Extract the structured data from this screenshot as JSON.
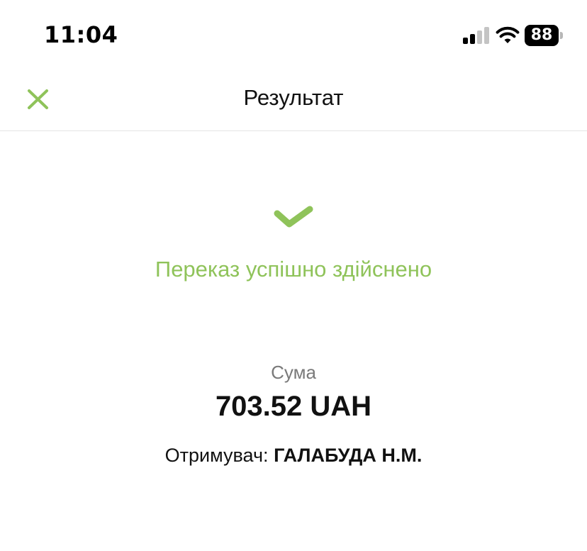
{
  "status_bar": {
    "time": "11:04",
    "battery_level": "88",
    "signal_strength_bars": 2,
    "signal_total_bars": 4,
    "icons": [
      "signal-icon",
      "wifi-icon",
      "battery-icon"
    ]
  },
  "header": {
    "title": "Результат",
    "close_icon": "close-icon"
  },
  "result": {
    "icon": "checkmark-icon",
    "message": "Переказ успішно здійснено"
  },
  "amount": {
    "label": "Сума",
    "value": "703.52 UAH"
  },
  "recipient": {
    "label": "Отримувач:",
    "name": "ГАЛАБУДА Н.М."
  },
  "colors": {
    "accent_green": "#8fc35a",
    "text_primary": "#111111",
    "text_secondary": "#7a7a7a",
    "divider": "#e4e4e4"
  }
}
